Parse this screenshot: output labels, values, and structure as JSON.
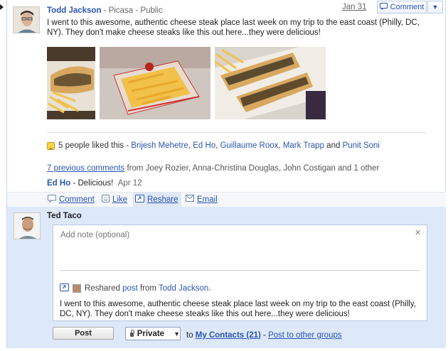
{
  "post": {
    "author": "Todd Jackson",
    "meta": " - Picasa - Public",
    "date": "Jan 31",
    "comment_button": "Comment",
    "text": "I went to this awesome, authentic cheese steak place last week on my trip to the east coast (Philly, DC, NY). They don't make cheese steaks like this out here...they were delicious!",
    "photos": [
      "cheese steak with fries",
      "cheese fries in paper tray",
      "cheese steaks in takeout box"
    ]
  },
  "likes": {
    "prefix": "5 people liked this - ",
    "names": [
      "Brijesh Mehetre",
      "Ed Ho",
      "Guillaume Roox",
      "Mark Trapp"
    ],
    "conj": " and ",
    "last": "Punit Soni",
    "sep": ", "
  },
  "comments": {
    "previous_link": "7 previous comments",
    "previous_rest": " from Joey Rozier, Anna-Christina Douglas, John Costigan and 1 other",
    "latest_author": "Ed Ho",
    "latest_text": " - Delicious!",
    "latest_date": "Apr 12"
  },
  "actions": {
    "comment": "Comment",
    "like": "Like",
    "reshare": "Reshare",
    "email": "Email"
  },
  "reshare": {
    "user": "Ted Taco",
    "note_placeholder": "Add note (optional)",
    "close": "×",
    "reshared_prefix": "Reshared ",
    "post_link": "post",
    "from": " from ",
    "from_author": "Todd Jackson",
    "from_end": ".",
    "quoted_text": "I went to this awesome, authentic cheese steak place last week on my trip to the east coast (Philly, DC, NY). They don't make cheese steaks like this out here...they were delicious!",
    "post_button": "Post",
    "privacy": "Private",
    "to": "to ",
    "my_contacts": "My Contacts (21)",
    "dash": " - ",
    "other_groups": "Post to other groups"
  },
  "colors": {
    "link": "#2a55b2",
    "reshare_bg": "#dde8f9",
    "action_bar_bg": "#f5f7fa"
  }
}
